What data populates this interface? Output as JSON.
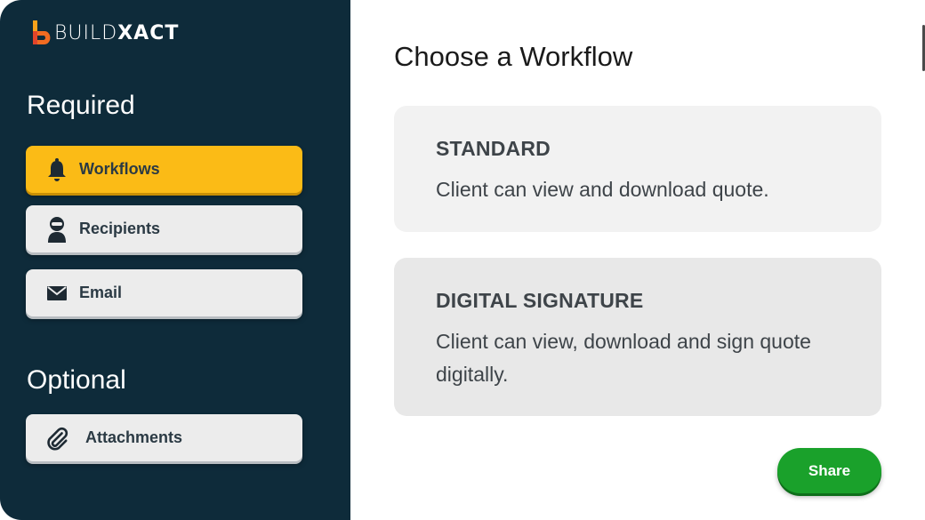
{
  "brand": {
    "part1": "BUILD",
    "part2": "XACT"
  },
  "sidebar": {
    "required_title": "Required",
    "optional_title": "Optional",
    "items": [
      {
        "label": "Workflows",
        "icon": "bell-icon",
        "active": true
      },
      {
        "label": "Recipients",
        "icon": "person-icon",
        "active": false
      },
      {
        "label": "Email",
        "icon": "envelope-icon",
        "active": false
      },
      {
        "label": "Attachments",
        "icon": "paperclip-icon",
        "active": false
      }
    ]
  },
  "main": {
    "title": "Choose a Workflow",
    "cards": [
      {
        "title": "STANDARD",
        "desc": "Client can view and download quote."
      },
      {
        "title": "DIGITAL SIGNATURE",
        "desc": "Client can view, download and sign quote digitally."
      }
    ],
    "share_label": "Share"
  },
  "colors": {
    "sidebar_bg": "#0e2b3a",
    "active_item": "#fbbb16",
    "share_button": "#1aa12b",
    "logo_orange": "#f26b21",
    "logo_red": "#d6312b"
  }
}
